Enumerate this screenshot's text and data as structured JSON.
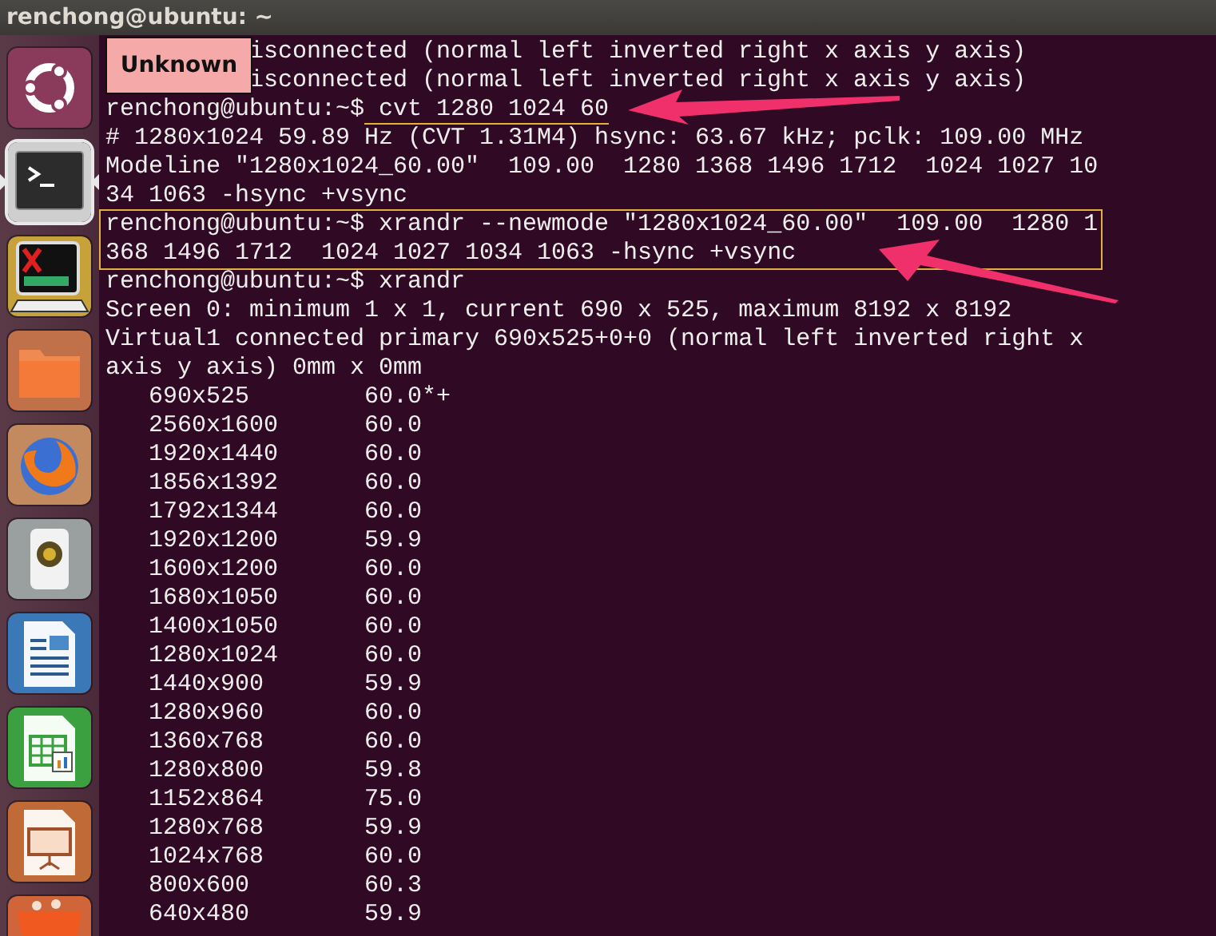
{
  "window": {
    "title": "renchong@ubuntu: ~"
  },
  "launcher": {
    "items": [
      {
        "kind": "dash",
        "active": false
      },
      {
        "kind": "terminal",
        "active": true
      },
      {
        "kind": "xterm",
        "active": false
      },
      {
        "kind": "files",
        "active": false
      },
      {
        "kind": "browser",
        "active": false
      },
      {
        "kind": "speaker",
        "active": false
      },
      {
        "kind": "writer",
        "active": false
      },
      {
        "kind": "calc",
        "active": false
      },
      {
        "kind": "impress",
        "active": false
      },
      {
        "kind": "bag",
        "active": false
      }
    ]
  },
  "tooltip": {
    "text": "Unknown"
  },
  "terminal": {
    "lines": [
      {
        "kind": "clipped",
        "text": "isconnected (normal left inverted right x axis y axis)"
      },
      {
        "kind": "clipped",
        "text": "isconnected (normal left inverted right x axis y axis)"
      },
      {
        "kind": "command",
        "prompt": "renchong@ubuntu:~$",
        "command": " cvt 1280 1024 60",
        "underline": true,
        "boxed": false,
        "arrow": true
      },
      {
        "kind": "output",
        "text": "# 1280x1024 59.89 Hz (CVT 1.31M4) hsync: 63.67 kHz; pclk: 109.00 MHz"
      },
      {
        "kind": "output",
        "text": "Modeline \"1280x1024_60.00\"  109.00  1280 1368 1496 1712  1024 1027 1034 1063 -hsync +vsync"
      },
      {
        "kind": "command",
        "prompt": "renchong@ubuntu:~$",
        "command": " xrandr --newmode \"1280x1024_60.00\"  109.00  1280 1368 1496 1712  1024 1027 1034 1063 -hsync +vsync",
        "underline": false,
        "boxed": true,
        "arrow": true
      },
      {
        "kind": "command",
        "prompt": "renchong@ubuntu:~$",
        "command": " xrandr",
        "underline": false,
        "boxed": false,
        "arrow": false
      },
      {
        "kind": "output",
        "text": "Screen 0: minimum 1 x 1, current 690 x 525, maximum 8192 x 8192"
      },
      {
        "kind": "output",
        "text": "Virtual1 connected primary 690x525+0+0 (normal left inverted right x axis y axis) 0mm x 0mm"
      },
      {
        "kind": "mode",
        "resolution": "690x525",
        "rate": "60.0*+"
      },
      {
        "kind": "mode",
        "resolution": "2560x1600",
        "rate": "60.0"
      },
      {
        "kind": "mode",
        "resolution": "1920x1440",
        "rate": "60.0"
      },
      {
        "kind": "mode",
        "resolution": "1856x1392",
        "rate": "60.0"
      },
      {
        "kind": "mode",
        "resolution": "1792x1344",
        "rate": "60.0"
      },
      {
        "kind": "mode",
        "resolution": "1920x1200",
        "rate": "59.9"
      },
      {
        "kind": "mode",
        "resolution": "1600x1200",
        "rate": "60.0"
      },
      {
        "kind": "mode",
        "resolution": "1680x1050",
        "rate": "60.0"
      },
      {
        "kind": "mode",
        "resolution": "1400x1050",
        "rate": "60.0"
      },
      {
        "kind": "mode",
        "resolution": "1280x1024",
        "rate": "60.0"
      },
      {
        "kind": "mode",
        "resolution": "1440x900",
        "rate": "59.9"
      },
      {
        "kind": "mode",
        "resolution": "1280x960",
        "rate": "60.0"
      },
      {
        "kind": "mode",
        "resolution": "1360x768",
        "rate": "60.0"
      },
      {
        "kind": "mode",
        "resolution": "1280x800",
        "rate": "59.8"
      },
      {
        "kind": "mode",
        "resolution": "1152x864",
        "rate": "75.0"
      },
      {
        "kind": "mode",
        "resolution": "1280x768",
        "rate": "59.9"
      },
      {
        "kind": "mode",
        "resolution": "1024x768",
        "rate": "60.0"
      },
      {
        "kind": "mode",
        "resolution": "800x600",
        "rate": "60.3"
      },
      {
        "kind": "mode",
        "resolution": "640x480",
        "rate": "59.9"
      }
    ]
  }
}
